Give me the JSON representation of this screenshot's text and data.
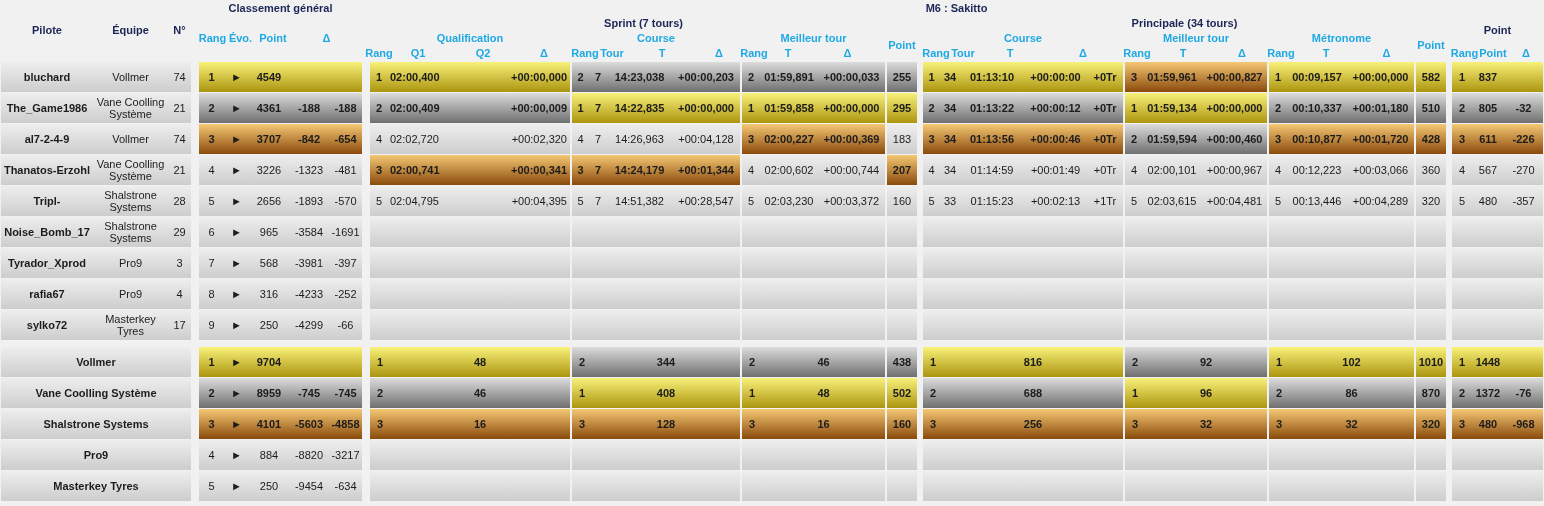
{
  "header": {
    "general_title": "Classement général",
    "event_title": "M6 : Sakitto",
    "pilot_columns": [
      "Pilote",
      "Équipe",
      "N°"
    ],
    "general_columns": [
      "Rang",
      "Évo.",
      "Point",
      "Δ"
    ],
    "stages": [
      {
        "title": "Sprint (7 tours)",
        "sections": [
          {
            "title": "Qualification",
            "columns": [
              "Rang",
              "Q1",
              "Q2",
              "Δ"
            ]
          },
          {
            "title": "Course",
            "columns": [
              "Rang",
              "Tour",
              "T",
              "Δ"
            ]
          },
          {
            "title": "Meilleur tour",
            "columns": [
              "Rang",
              "T",
              "Δ"
            ]
          },
          {
            "title": "Point"
          }
        ]
      },
      {
        "title": "Principale (34 tours)",
        "sections": [
          {
            "title": "Course",
            "columns": [
              "Rang",
              "Tour",
              "T",
              "Δ"
            ]
          },
          {
            "title": "Meilleur tour",
            "columns": [
              "Rang",
              "T",
              "Δ"
            ]
          },
          {
            "title": "Métronome",
            "columns": [
              "Rang",
              "T",
              "Δ"
            ]
          },
          {
            "title": "Point"
          }
        ]
      }
    ],
    "final": {
      "title": "Point",
      "columns": [
        "Rang",
        "Point",
        "Δ"
      ]
    }
  },
  "pilots": [
    {
      "name": "bluchard",
      "team": "Vollmer",
      "number": "74",
      "general": {
        "kind": "gold",
        "rang": "1",
        "evo": "►",
        "point": "4549"
      },
      "qualification": {
        "kind": "gold",
        "rang": "1",
        "q1": "02:00,400",
        "delta": "+00:00,000"
      },
      "sprint_course": {
        "kind": "silver",
        "rang": "2",
        "laps": "7",
        "time": "14:23,038",
        "delta": "+00:00,203"
      },
      "sprint_best": {
        "kind": "silver",
        "rang": "2",
        "time": "01:59,891",
        "delta": "+00:00,033"
      },
      "sprint_points": {
        "kind": "silver",
        "points": "255"
      },
      "main_course": {
        "kind": "gold",
        "rang": "1",
        "laps": "34",
        "time": "01:13:10",
        "delta": "+00:00:00",
        "lap_gap": "+0Tr"
      },
      "main_best": {
        "kind": "bronze",
        "rang": "3",
        "time": "01:59,961",
        "delta": "+00:00,827"
      },
      "metronome": {
        "kind": "gold",
        "rang": "1",
        "time": "00:09,157",
        "delta": "+00:00,000"
      },
      "main_points": {
        "kind": "gold",
        "points": "582"
      },
      "final": {
        "kind": "gold",
        "rang": "1",
        "points": "837"
      }
    },
    {
      "name": "The_Game1986",
      "team": "Vane Coolling Système",
      "number": "21",
      "general": {
        "kind": "silver",
        "rang": "2",
        "evo": "►",
        "point": "4361",
        "delta_leader": "-188",
        "delta_prev": "-188"
      },
      "qualification": {
        "kind": "silver",
        "rang": "2",
        "q1": "02:00,409",
        "delta": "+00:00,009"
      },
      "sprint_course": {
        "kind": "gold",
        "rang": "1",
        "laps": "7",
        "time": "14:22,835",
        "delta": "+00:00,000"
      },
      "sprint_best": {
        "kind": "gold",
        "rang": "1",
        "time": "01:59,858",
        "delta": "+00:00,000"
      },
      "sprint_points": {
        "kind": "gold",
        "points": "295"
      },
      "main_course": {
        "kind": "silver",
        "rang": "2",
        "laps": "34",
        "time": "01:13:22",
        "delta": "+00:00:12",
        "lap_gap": "+0Tr"
      },
      "main_best": {
        "kind": "gold",
        "rang": "1",
        "time": "01:59,134",
        "delta": "+00:00,000"
      },
      "metronome": {
        "kind": "silver",
        "rang": "2",
        "time": "00:10,337",
        "delta": "+00:01,180"
      },
      "main_points": {
        "kind": "silver",
        "points": "510"
      },
      "final": {
        "kind": "silver",
        "rang": "2",
        "points": "805",
        "delta": "-32"
      }
    },
    {
      "name": "al7-2-4-9",
      "team": "Vollmer",
      "number": "74",
      "general": {
        "kind": "bronze",
        "rang": "3",
        "evo": "►",
        "point": "3707",
        "delta_leader": "-842",
        "delta_prev": "-654"
      },
      "qualification": {
        "kind": "none",
        "rang": "4",
        "q1": "02:02,720",
        "delta": "+00:02,320"
      },
      "sprint_course": {
        "kind": "none",
        "rang": "4",
        "laps": "7",
        "time": "14:26,963",
        "delta": "+00:04,128"
      },
      "sprint_best": {
        "kind": "bronze",
        "rang": "3",
        "time": "02:00,227",
        "delta": "+00:00,369"
      },
      "sprint_points": {
        "kind": "none",
        "points": "183"
      },
      "main_course": {
        "kind": "bronze",
        "rang": "3",
        "laps": "34",
        "time": "01:13:56",
        "delta": "+00:00:46",
        "lap_gap": "+0Tr"
      },
      "main_best": {
        "kind": "silver",
        "rang": "2",
        "time": "01:59,594",
        "delta": "+00:00,460"
      },
      "metronome": {
        "kind": "bronze",
        "rang": "3",
        "time": "00:10,877",
        "delta": "+00:01,720"
      },
      "main_points": {
        "kind": "bronze",
        "points": "428"
      },
      "final": {
        "kind": "bronze",
        "rang": "3",
        "points": "611",
        "delta": "-226"
      }
    },
    {
      "name": "Thanatos-Erzohl",
      "team": "Vane Coolling Système",
      "number": "21",
      "general": {
        "kind": "none",
        "rang": "4",
        "evo": "►",
        "point": "3226",
        "delta_leader": "-1323",
        "delta_prev": "-481"
      },
      "qualification": {
        "kind": "bronze",
        "rang": "3",
        "q1": "02:00,741",
        "delta": "+00:00,341"
      },
      "sprint_course": {
        "kind": "bronze",
        "rang": "3",
        "laps": "7",
        "time": "14:24,179",
        "delta": "+00:01,344"
      },
      "sprint_best": {
        "kind": "none",
        "rang": "4",
        "time": "02:00,602",
        "delta": "+00:00,744"
      },
      "sprint_points": {
        "kind": "bronze",
        "points": "207"
      },
      "main_course": {
        "kind": "none",
        "rang": "4",
        "laps": "34",
        "time": "01:14:59",
        "delta": "+00:01:49",
        "lap_gap": "+0Tr"
      },
      "main_best": {
        "kind": "none",
        "rang": "4",
        "time": "02:00,101",
        "delta": "+00:00,967"
      },
      "metronome": {
        "kind": "none",
        "rang": "4",
        "time": "00:12,223",
        "delta": "+00:03,066"
      },
      "main_points": {
        "kind": "none",
        "points": "360"
      },
      "final": {
        "kind": "none",
        "rang": "4",
        "points": "567",
        "delta": "-270"
      }
    },
    {
      "name": "Tripl-",
      "team": "Shalstrone Systems",
      "number": "28",
      "general": {
        "kind": "none",
        "rang": "5",
        "evo": "►",
        "point": "2656",
        "delta_leader": "-1893",
        "delta_prev": "-570"
      },
      "qualification": {
        "kind": "none",
        "rang": "5",
        "q1": "02:04,795",
        "delta": "+00:04,395"
      },
      "sprint_course": {
        "kind": "none",
        "rang": "5",
        "laps": "7",
        "time": "14:51,382",
        "delta": "+00:28,547"
      },
      "sprint_best": {
        "kind": "none",
        "rang": "5",
        "time": "02:03,230",
        "delta": "+00:03,372"
      },
      "sprint_points": {
        "kind": "none",
        "points": "160"
      },
      "main_course": {
        "kind": "none",
        "rang": "5",
        "laps": "33",
        "time": "01:15:23",
        "delta": "+00:02:13",
        "lap_gap": "+1Tr"
      },
      "main_best": {
        "kind": "none",
        "rang": "5",
        "time": "02:03,615",
        "delta": "+00:04,481"
      },
      "metronome": {
        "kind": "none",
        "rang": "5",
        "time": "00:13,446",
        "delta": "+00:04,289"
      },
      "main_points": {
        "kind": "none",
        "points": "320"
      },
      "final": {
        "kind": "none",
        "rang": "5",
        "points": "480",
        "delta": "-357"
      }
    },
    {
      "name": "Noise_Bomb_17",
      "team": "Shalstrone Systems",
      "number": "29",
      "general": {
        "kind": "none",
        "rang": "6",
        "evo": "►",
        "point": "965",
        "delta_leader": "-3584",
        "delta_prev": "-1691"
      }
    },
    {
      "name": "Tyrador_Xprod",
      "team": "Pro9",
      "number": "3",
      "general": {
        "kind": "none",
        "rang": "7",
        "evo": "►",
        "point": "568",
        "delta_leader": "-3981",
        "delta_prev": "-397"
      }
    },
    {
      "name": "rafia67",
      "team": "Pro9",
      "number": "4",
      "general": {
        "kind": "none",
        "rang": "8",
        "evo": "►",
        "point": "316",
        "delta_leader": "-4233",
        "delta_prev": "-252"
      }
    },
    {
      "name": "sylko72",
      "team": "Masterkey Tyres",
      "number": "17",
      "general": {
        "kind": "none",
        "rang": "9",
        "evo": "►",
        "point": "250",
        "delta_leader": "-4299",
        "delta_prev": "-66"
      }
    }
  ],
  "teams": [
    {
      "name": "Vollmer",
      "general": {
        "kind": "gold",
        "rang": "1",
        "evo": "►",
        "point": "9704"
      },
      "qualification": {
        "kind": "gold",
        "rang": "1",
        "points": "48"
      },
      "sprint_course": {
        "kind": "silver",
        "rang": "2",
        "points": "344"
      },
      "sprint_best": {
        "kind": "silver",
        "rang": "2",
        "points": "46"
      },
      "sprint_points": {
        "kind": "silver",
        "points": "438"
      },
      "main_course": {
        "kind": "gold",
        "rang": "1",
        "points": "816"
      },
      "main_best": {
        "kind": "silver",
        "rang": "2",
        "points": "92"
      },
      "metronome": {
        "kind": "gold",
        "rang": "1",
        "points": "102"
      },
      "main_points": {
        "kind": "gold",
        "points": "1010"
      },
      "final": {
        "kind": "gold",
        "rang": "1",
        "points": "1448"
      }
    },
    {
      "name": "Vane Coolling Système",
      "general": {
        "kind": "silver",
        "rang": "2",
        "evo": "►",
        "point": "8959",
        "delta_leader": "-745",
        "delta_prev": "-745"
      },
      "qualification": {
        "kind": "silver",
        "rang": "2",
        "points": "46"
      },
      "sprint_course": {
        "kind": "gold",
        "rang": "1",
        "points": "408"
      },
      "sprint_best": {
        "kind": "gold",
        "rang": "1",
        "points": "48"
      },
      "sprint_points": {
        "kind": "gold",
        "points": "502"
      },
      "main_course": {
        "kind": "silver",
        "rang": "2",
        "points": "688"
      },
      "main_best": {
        "kind": "gold",
        "rang": "1",
        "points": "96"
      },
      "metronome": {
        "kind": "silver",
        "rang": "2",
        "points": "86"
      },
      "main_points": {
        "kind": "silver",
        "points": "870"
      },
      "final": {
        "kind": "silver",
        "rang": "2",
        "points": "1372",
        "delta": "-76"
      }
    },
    {
      "name": "Shalstrone Systems",
      "general": {
        "kind": "bronze",
        "rang": "3",
        "evo": "►",
        "point": "4101",
        "delta_leader": "-5603",
        "delta_prev": "-4858"
      },
      "qualification": {
        "kind": "bronze",
        "rang": "3",
        "points": "16"
      },
      "sprint_course": {
        "kind": "bronze",
        "rang": "3",
        "points": "128"
      },
      "sprint_best": {
        "kind": "bronze",
        "rang": "3",
        "points": "16"
      },
      "sprint_points": {
        "kind": "bronze",
        "points": "160"
      },
      "main_course": {
        "kind": "bronze",
        "rang": "3",
        "points": "256"
      },
      "main_best": {
        "kind": "bronze",
        "rang": "3",
        "points": "32"
      },
      "metronome": {
        "kind": "bronze",
        "rang": "3",
        "points": "32"
      },
      "main_points": {
        "kind": "bronze",
        "points": "320"
      },
      "final": {
        "kind": "bronze",
        "rang": "3",
        "points": "480",
        "delta": "-968"
      }
    },
    {
      "name": "Pro9",
      "general": {
        "kind": "none",
        "rang": "4",
        "evo": "►",
        "point": "884",
        "delta_leader": "-8820",
        "delta_prev": "-3217"
      }
    },
    {
      "name": "Masterkey Tyres",
      "general": {
        "kind": "none",
        "rang": "5",
        "evo": "►",
        "point": "250",
        "delta_leader": "-9454",
        "delta_prev": "-634"
      }
    }
  ]
}
